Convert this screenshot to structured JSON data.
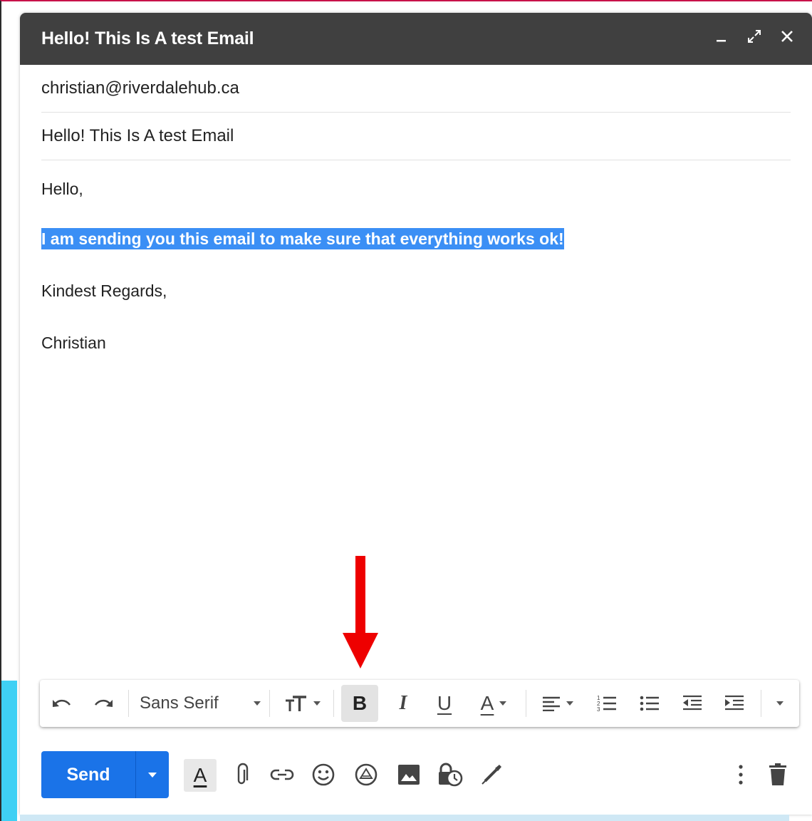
{
  "window": {
    "title": "Hello! This Is A test Email"
  },
  "fields": {
    "to": "christian@riverdalehub.ca",
    "subject": "Hello! This Is A test Email"
  },
  "body": {
    "greeting": "Hello,",
    "selected_line": "I am sending you this email to make sure that everything works ok!",
    "closing": "Kindest Regards,",
    "signature": "Christian"
  },
  "format_toolbar": {
    "font": "Sans Serif",
    "bold_label": "B",
    "italic_label": "I",
    "underline_label": "U",
    "text_color_label": "A",
    "icons": [
      "undo-icon",
      "redo-icon",
      "font-size-icon",
      "bold-icon",
      "italic-icon",
      "underline-icon",
      "text-color-icon",
      "align-icon",
      "numbered-list-icon",
      "bulleted-list-icon",
      "indent-less-icon",
      "indent-more-icon",
      "more-formatting-icon"
    ]
  },
  "bottom_toolbar": {
    "send_label": "Send",
    "formatting_label": "A",
    "icons": [
      "formatting-options-icon",
      "attach-icon",
      "link-icon",
      "emoji-icon",
      "drive-icon",
      "photo-icon",
      "confidential-icon",
      "signature-icon",
      "more-options-icon",
      "delete-icon"
    ]
  },
  "colors": {
    "title_bar": "#404040",
    "selection": "#3b8ff5",
    "send_button": "#1a73e8",
    "annotation_arrow": "#ee0000",
    "accent_cyan": "#3fd0f4"
  }
}
